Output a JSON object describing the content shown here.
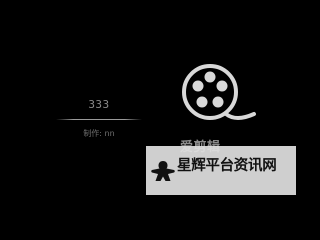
{
  "credit": {
    "number": "333",
    "author": "制作: nn"
  },
  "logo": {
    "icon": "film-reel-icon",
    "name": "爱剪辑"
  },
  "watermark": {
    "icon": "meeple-icon",
    "text": "星辉平台资讯网"
  },
  "colors": {
    "background": "#000000",
    "watermark_bg": "#e1e1e1"
  }
}
